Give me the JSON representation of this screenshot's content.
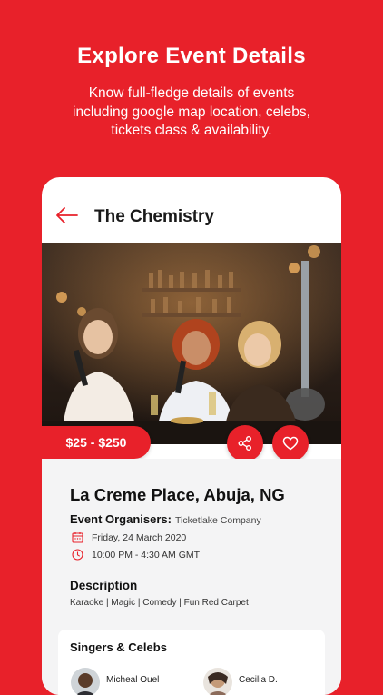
{
  "promo": {
    "title": "Explore Event Details",
    "subtitle_line1": "Know full-fledge details of events",
    "subtitle_line2": "including google map location, celebs,",
    "subtitle_line3": "tickets class & availability."
  },
  "header": {
    "back_icon": "arrow-left-icon",
    "title": "The Chemistry"
  },
  "event": {
    "price": "$25 - $250",
    "venue": "La Creme Place, Abuja, NG",
    "organisers_label": "Event Organisers:",
    "organiser_name": "Ticketlake Company",
    "date": "Friday, 24 March 2020",
    "time": "10:00 PM - 4:30 AM GMT",
    "description_heading": "Description",
    "description_text": "Karaoke | Magic | Comedy | Fun Red Carpet"
  },
  "celebs": {
    "heading": "Singers & Celebs",
    "items": [
      {
        "name": "Micheal Ouel"
      },
      {
        "name": "Cecilia D."
      }
    ]
  },
  "colors": {
    "brand": "#e8212a",
    "card_bg": "#f4f4f5"
  }
}
